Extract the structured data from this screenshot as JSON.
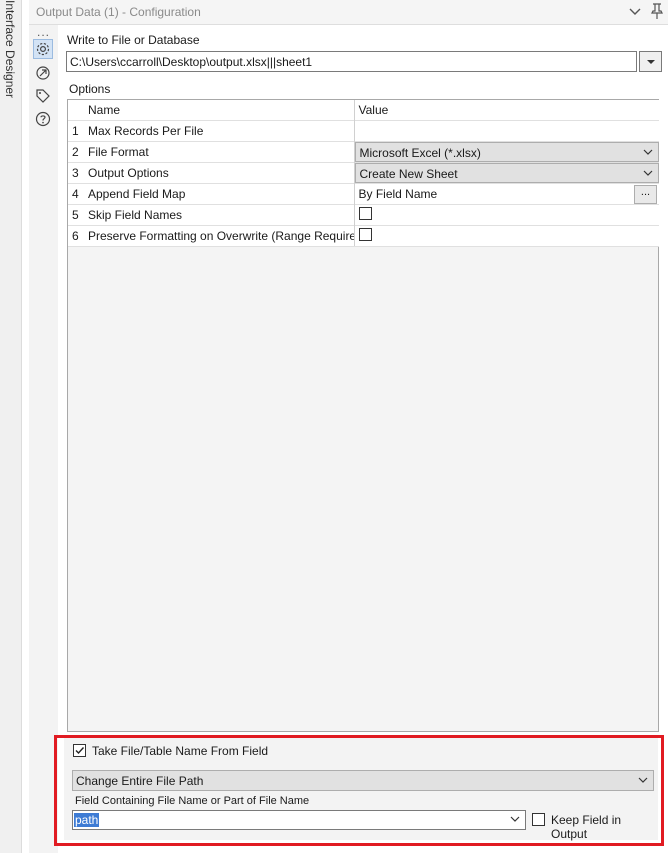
{
  "side_panel": {
    "label": "Interface Designer"
  },
  "window": {
    "title": "Output Data (1) - Configuration"
  },
  "icon_rail": {
    "overflow": "...",
    "icons": [
      "gear-icon",
      "arrow-cycle-icon",
      "tag-icon",
      "help-icon"
    ]
  },
  "write_to": {
    "label": "Write to File or Database",
    "value": "C:\\Users\\ccarroll\\Desktop\\output.xlsx|||sheet1"
  },
  "options": {
    "label": "Options",
    "columns": {
      "name": "Name",
      "value": "Value"
    },
    "rows": [
      {
        "num": "1",
        "name": "Max Records Per File",
        "value": ""
      },
      {
        "num": "2",
        "name": "File Format",
        "value": "Microsoft Excel (*.xlsx)"
      },
      {
        "num": "3",
        "name": "Output Options",
        "value": "Create New Sheet"
      },
      {
        "num": "4",
        "name": "Append Field Map",
        "value": "By Field Name",
        "button": "..."
      },
      {
        "num": "5",
        "name": "Skip Field Names",
        "checked": false
      },
      {
        "num": "6",
        "name": "Preserve Formatting on Overwrite (Range Required)",
        "checked": false
      }
    ]
  },
  "take_from_field": {
    "checked": true,
    "label": "Take File/Table Name From Field",
    "mode": "Change Entire File Path",
    "field_label": "Field Containing File Name or Part of File Name",
    "field_value": "path",
    "keep_label": "Keep Field in Output",
    "keep_checked": false
  },
  "colors": {
    "highlight": "#e11b22",
    "selection": "#3d7bd4"
  }
}
